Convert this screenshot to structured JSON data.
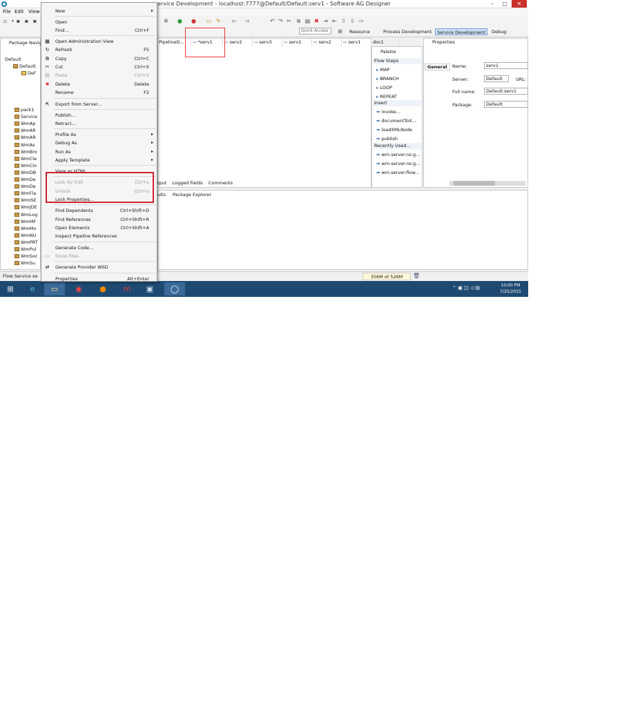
{
  "window": {
    "title": "ervice Development - localhost:7777@Default/Default:serv1 - Software AG Designer",
    "min_label": "–",
    "max_label": "□",
    "close_label": "✕"
  },
  "menubar": {
    "file": "File",
    "edit": "Edit",
    "view": "View"
  },
  "toolbar": {
    "quick_access": "Quick Access",
    "perspectives": [
      {
        "label": "Resource"
      },
      {
        "label": "Process Development"
      },
      {
        "label": "Service Development"
      },
      {
        "label": "Debug"
      }
    ]
  },
  "navigator": {
    "title": "Package Navig",
    "tree": {
      "root": "Default",
      "pkg": "Default",
      "folder": "Def",
      "packages": [
        "pack1",
        "Service",
        "WmAp",
        "WmAR",
        "WmAR",
        "WmAs",
        "WmBro",
        "WmCle",
        "WmClo",
        "WmDB",
        "WmDe",
        "WmDe",
        "WmFla",
        "WmISE",
        "WmJDE",
        "WmLog",
        "WmMF",
        "WmMo",
        "WmNU",
        "WmPRT",
        "WmPul",
        "WmSoc",
        "WmSu"
      ]
    }
  },
  "editor_tabs": [
    "PipelineD...",
    "*serv1",
    "serv2",
    "serv3",
    "serv1",
    "serv2",
    "serv1",
    "doc1"
  ],
  "palette": {
    "title": "Palette",
    "flow_steps_title": "Flow Steps",
    "flow_steps": [
      "MAP",
      "BRANCH",
      "LOOP",
      "REPEAT"
    ],
    "insert_title": "Insert",
    "insert_items": [
      "invoke...",
      "documentToX...",
      "loadXMLNode",
      "publish"
    ],
    "recent_title": "Recently Used...",
    "recent_items": [
      "wm.server.ns:g...",
      "wm.server.ns:g...",
      "wm.server.flow..."
    ]
  },
  "properties": {
    "title": "Properties",
    "tab": "General",
    "name_label": "Name:",
    "name_value": "serv1",
    "server_label": "Server:",
    "server_value": "Default",
    "url_label": "URL:",
    "fullname_label": "Full name:",
    "fullname_value": "Default:serv1",
    "package_label": "Package:",
    "package_value": "Default"
  },
  "bottom_tabs": [
    "tput",
    "Logged Fields",
    "Comments"
  ],
  "lower_tabs": [
    "ults",
    "Package Explorer"
  ],
  "status": {
    "left": "Flow Service se",
    "memory": "356M of 526M"
  },
  "taskbar": {
    "time": "10:00 PM",
    "date": "7/25/2015"
  },
  "context_menu": {
    "items": [
      {
        "label": "New",
        "shortcut": "",
        "submenu": true,
        "disabled": false
      },
      {
        "label": "Open",
        "shortcut": "",
        "disabled": false
      },
      {
        "label": "Find...",
        "shortcut": "Ctrl+F",
        "disabled": false
      },
      {
        "label": "Open Administration View",
        "shortcut": "",
        "disabled": false
      },
      {
        "label": "Refresh",
        "shortcut": "F5",
        "disabled": false
      },
      {
        "label": "Copy",
        "shortcut": "Ctrl+C",
        "disabled": false
      },
      {
        "label": "Cut",
        "shortcut": "Ctrl+X",
        "disabled": false
      },
      {
        "label": "Paste",
        "shortcut": "Ctrl+V",
        "disabled": true
      },
      {
        "label": "Delete",
        "shortcut": "Delete",
        "disabled": false
      },
      {
        "label": "Rename",
        "shortcut": "F2",
        "disabled": false
      },
      {
        "label": "Export from Server...",
        "shortcut": "",
        "disabled": false
      },
      {
        "label": "Publish...",
        "shortcut": "",
        "disabled": false
      },
      {
        "label": "Retract...",
        "shortcut": "",
        "disabled": false
      },
      {
        "label": "Profile As",
        "shortcut": "",
        "submenu": true,
        "disabled": false
      },
      {
        "label": "Debug As",
        "shortcut": "",
        "submenu": true,
        "disabled": false
      },
      {
        "label": "Run As",
        "shortcut": "",
        "submenu": true,
        "disabled": false
      },
      {
        "label": "Apply Template",
        "shortcut": "",
        "submenu": true,
        "disabled": false
      },
      {
        "label": "View as HTML",
        "shortcut": "",
        "disabled": false
      },
      {
        "label": "Lock for Edit",
        "shortcut": "Ctrl+L",
        "disabled": true
      },
      {
        "label": "Unlock",
        "shortcut": "Ctrl+U",
        "disabled": true
      },
      {
        "label": "Lock Properties...",
        "shortcut": "",
        "disabled": false
      },
      {
        "label": "Find Dependents",
        "shortcut": "Ctrl+Shift+D",
        "disabled": false
      },
      {
        "label": "Find References",
        "shortcut": "Ctrl+Shift+R",
        "disabled": false
      },
      {
        "label": "Open Elements",
        "shortcut": "Ctrl+Shift+A",
        "disabled": false
      },
      {
        "label": "Inspect Pipeline References",
        "shortcut": "",
        "disabled": false
      },
      {
        "label": "Generate Code...",
        "shortcut": "",
        "disabled": false
      },
      {
        "label": "Show Files",
        "shortcut": "",
        "disabled": true
      },
      {
        "label": "Generate Provider WSD",
        "shortcut": "",
        "disabled": false
      },
      {
        "label": "Properties",
        "shortcut": "Alt+Enter",
        "disabled": false
      }
    ]
  }
}
